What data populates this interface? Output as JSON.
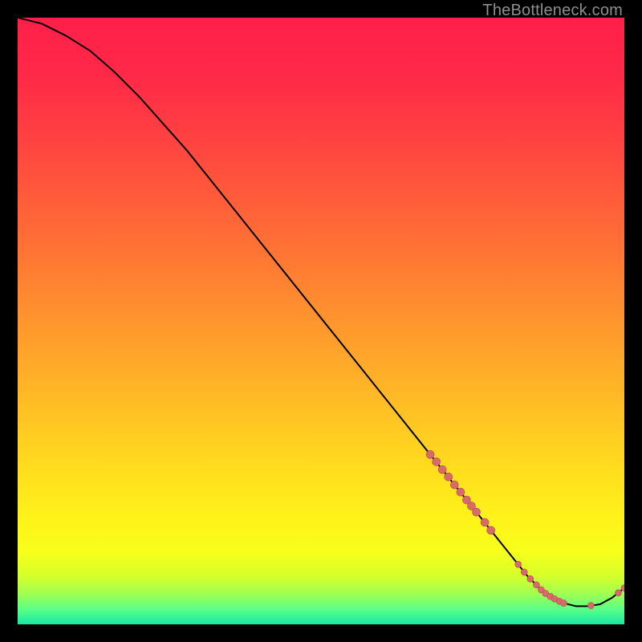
{
  "watermark": "TheBottleneck.com",
  "colors": {
    "gradient_stops": [
      {
        "offset": 0.0,
        "color": "#ff1f4a"
      },
      {
        "offset": 0.1,
        "color": "#ff2a47"
      },
      {
        "offset": 0.22,
        "color": "#ff4740"
      },
      {
        "offset": 0.35,
        "color": "#ff6a36"
      },
      {
        "offset": 0.48,
        "color": "#ff8f2f"
      },
      {
        "offset": 0.6,
        "color": "#ffb227"
      },
      {
        "offset": 0.72,
        "color": "#ffd61f"
      },
      {
        "offset": 0.82,
        "color": "#fff11a"
      },
      {
        "offset": 0.88,
        "color": "#f7ff1a"
      },
      {
        "offset": 0.92,
        "color": "#d6ff2a"
      },
      {
        "offset": 0.95,
        "color": "#9fff52"
      },
      {
        "offset": 0.975,
        "color": "#5bff87"
      },
      {
        "offset": 1.0,
        "color": "#17e8a3"
      }
    ],
    "curve": "#000000",
    "marker_fill": "#d86a6a",
    "marker_stroke": "#b24f4f"
  },
  "chart_data": {
    "type": "line",
    "title": "",
    "xlabel": "",
    "ylabel": "",
    "xlim": [
      0,
      100
    ],
    "ylim": [
      0,
      100
    ],
    "grid": false,
    "legend": false,
    "series": [
      {
        "name": "curve",
        "x": [
          0,
          4,
          8,
          12,
          16,
          20,
          24,
          28,
          32,
          36,
          40,
          44,
          48,
          52,
          56,
          60,
          64,
          68,
          72,
          74,
          76,
          78,
          80,
          82,
          84,
          86,
          88,
          90,
          92,
          94,
          96,
          98,
          100
        ],
        "y": [
          100,
          99,
          97,
          94.5,
          91,
          87,
          82.5,
          78,
          73,
          68,
          63,
          58,
          53,
          48,
          43,
          38,
          33,
          28,
          23,
          20.5,
          18,
          15.5,
          13,
          10.5,
          8,
          6,
          4.5,
          3.5,
          3,
          3,
          3.3,
          4.4,
          6
        ]
      }
    ],
    "markers": [
      {
        "x": 68,
        "y": 28,
        "r": 5
      },
      {
        "x": 69,
        "y": 26.8,
        "r": 5
      },
      {
        "x": 70,
        "y": 25.5,
        "r": 5
      },
      {
        "x": 71,
        "y": 24.3,
        "r": 5
      },
      {
        "x": 72,
        "y": 23,
        "r": 5
      },
      {
        "x": 73,
        "y": 21.8,
        "r": 5
      },
      {
        "x": 74,
        "y": 20.5,
        "r": 5
      },
      {
        "x": 74.8,
        "y": 19.5,
        "r": 5
      },
      {
        "x": 75.6,
        "y": 18.5,
        "r": 5
      },
      {
        "x": 77,
        "y": 16.8,
        "r": 5
      },
      {
        "x": 78,
        "y": 15.5,
        "r": 5
      },
      {
        "x": 82.5,
        "y": 9.9,
        "r": 4
      },
      {
        "x": 83.5,
        "y": 8.6,
        "r": 4
      },
      {
        "x": 84.5,
        "y": 7.5,
        "r": 4
      },
      {
        "x": 85.5,
        "y": 6.5,
        "r": 4
      },
      {
        "x": 86.3,
        "y": 5.7,
        "r": 4
      },
      {
        "x": 87,
        "y": 5.1,
        "r": 4
      },
      {
        "x": 87.8,
        "y": 4.6,
        "r": 4
      },
      {
        "x": 88.5,
        "y": 4.2,
        "r": 4
      },
      {
        "x": 89.3,
        "y": 3.8,
        "r": 4
      },
      {
        "x": 90,
        "y": 3.5,
        "r": 4
      },
      {
        "x": 94.5,
        "y": 3.1,
        "r": 4
      },
      {
        "x": 99,
        "y": 5.2,
        "r": 4
      },
      {
        "x": 100,
        "y": 6,
        "r": 4
      }
    ]
  }
}
